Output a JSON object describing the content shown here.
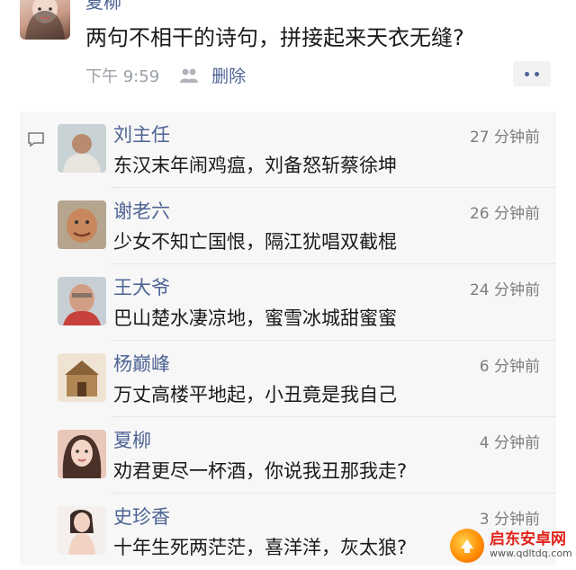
{
  "post": {
    "author": "夏柳",
    "text": "两句不相干的诗句，拼接起来天衣无缝?",
    "time": "下午 9:59",
    "delete_label": "删除",
    "avatar_icon": "avatar-photo-icon",
    "more_icon": "more-dots-icon",
    "people_icon": "people-icon"
  },
  "comments_icon": "comment-bubble-icon",
  "comments": [
    {
      "name": "刘主任",
      "time": "27 分钟前",
      "text": "东汉末年闹鸡瘟，刘备怒斩蔡徐坤"
    },
    {
      "name": "谢老六",
      "time": "26 分钟前",
      "text": "少女不知亡国恨，隔江犹唱双截棍"
    },
    {
      "name": "王大爷",
      "time": "24 分钟前",
      "text": "巴山楚水凄凉地，蜜雪冰城甜蜜蜜"
    },
    {
      "name": "杨巅峰",
      "time": "6 分钟前",
      "text": "万丈高楼平地起，小丑竟是我自己"
    },
    {
      "name": "夏柳",
      "time": "4 分钟前",
      "text": "劝君更尽一杯酒，你说我丑那我走?"
    },
    {
      "name": "史珍香",
      "time": "3 分钟前",
      "text": "十年生死两茫茫，喜洋洋，灰太狼?"
    }
  ],
  "watermark": {
    "name": "启东安卓网",
    "url": "www.qdltdq.com"
  }
}
